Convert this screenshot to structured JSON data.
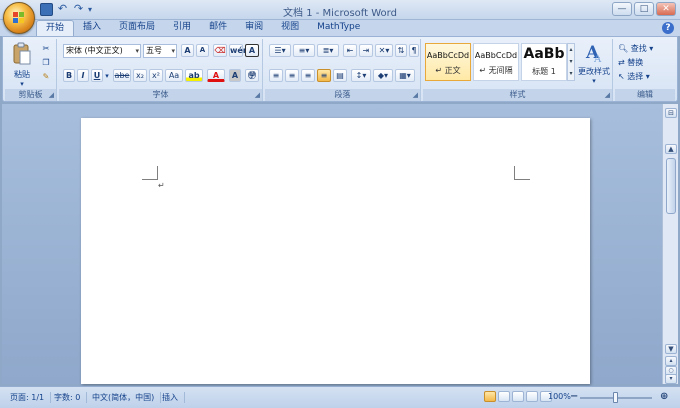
{
  "window": {
    "title": "文档 1 - Microsoft Word",
    "controls": [
      "—",
      "□",
      "✕"
    ],
    "help_label": "?"
  },
  "tabs": [
    {
      "label": "开始",
      "active": true
    },
    {
      "label": "插入"
    },
    {
      "label": "页面布局"
    },
    {
      "label": "引用"
    },
    {
      "label": "邮件"
    },
    {
      "label": "审阅"
    },
    {
      "label": "视图"
    },
    {
      "label": "MathType"
    }
  ],
  "ribbon": {
    "clipboard": {
      "group_label": "剪贴板",
      "paste_label": "粘贴"
    },
    "font": {
      "group_label": "字体",
      "font_name": "宋体 (中文正文)",
      "font_size": "五号",
      "buttons": [
        "B",
        "I",
        "U",
        "abe",
        "x₂",
        "x²",
        "Aa",
        "A",
        "A",
        "wén"
      ],
      "grow_label": "A",
      "shrink_label": "A"
    },
    "paragraph": {
      "group_label": "段落"
    },
    "styles": {
      "group_label": "样式",
      "items": [
        {
          "sample": "AaBbCcDd",
          "name": "↵ 正文",
          "selected": true
        },
        {
          "sample": "AaBbCcDd",
          "name": "↵ 无间隔"
        },
        {
          "sample": "AaBb",
          "name": "标题 1"
        }
      ],
      "change_styles_label": "更改样式"
    },
    "editing": {
      "group_label": "编辑",
      "find_label": "查找",
      "replace_label": "替换",
      "select_label": "选择"
    }
  },
  "document": {
    "paragraph_mark": "↵"
  },
  "status": {
    "page": "页面: 1/1",
    "words": "字数: 0",
    "language": "中文(简体，中国)",
    "mode": "插入",
    "zoom": "100%",
    "zoom_level_percent": 100
  },
  "colors": {
    "ribbon_bg": "#d6e3f4",
    "accent_highlight": "#ffe9a6",
    "font_color_red": "#e01010",
    "highlight_yellow": "#f4f000"
  }
}
